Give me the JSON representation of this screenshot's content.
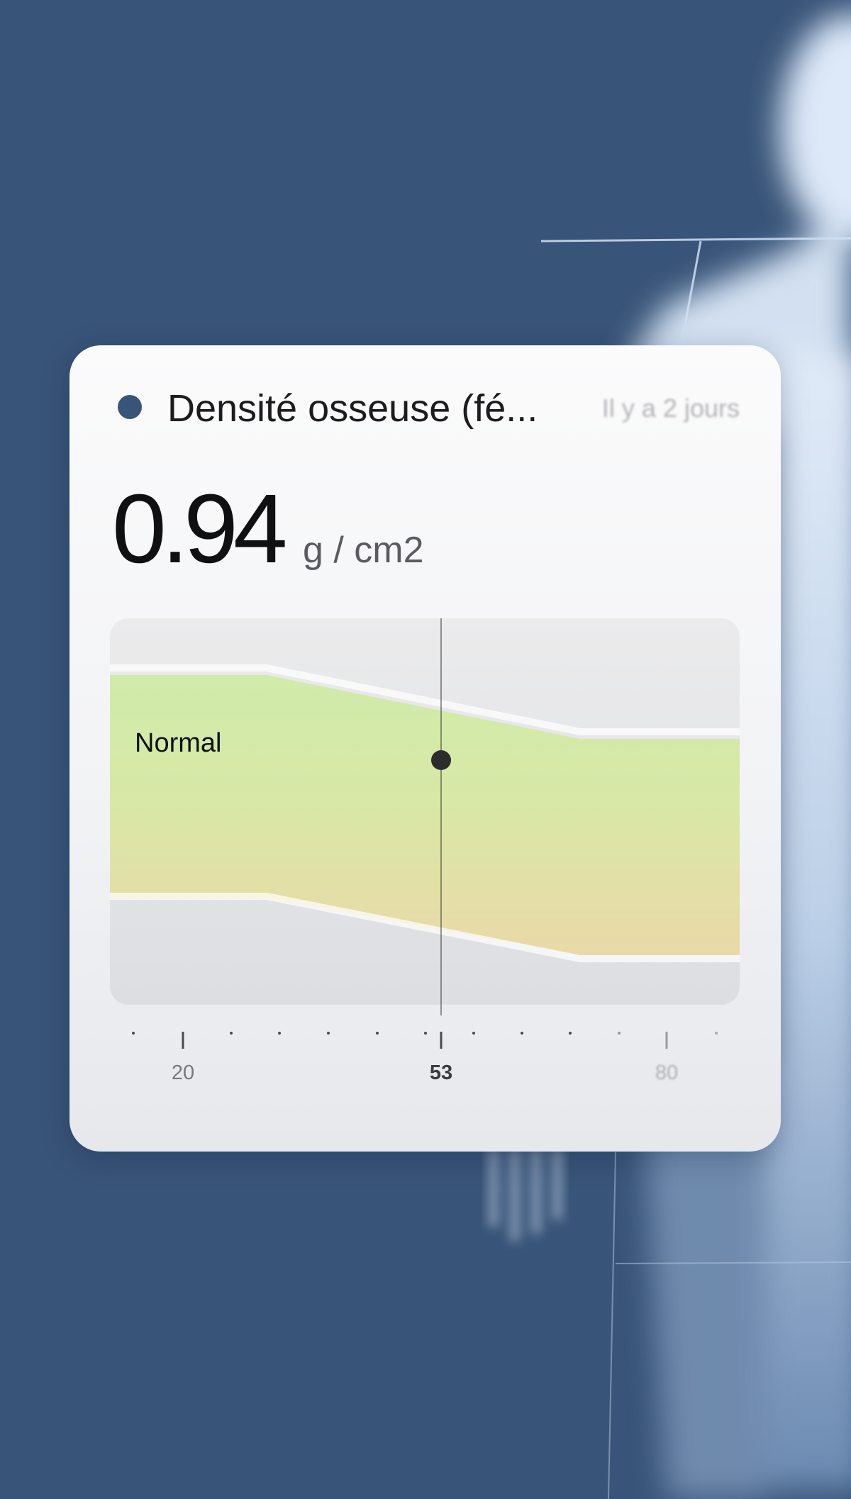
{
  "card": {
    "title": "Densité osseuse (fé...",
    "timestamp": "Il y a 2 jours",
    "value": "0.94",
    "unit": "g / cm2",
    "accent_color": "#385478"
  },
  "chart_data": {
    "type": "area",
    "x_ticks": [
      "20",
      "53",
      "80"
    ],
    "current_x": 53,
    "zone_label": "Normal",
    "zone_colors": {
      "top": "#d0ebaa",
      "bottom": "#ead9a8"
    },
    "marker_color": "#2c2c2c"
  },
  "background": {
    "color": "#385478"
  }
}
